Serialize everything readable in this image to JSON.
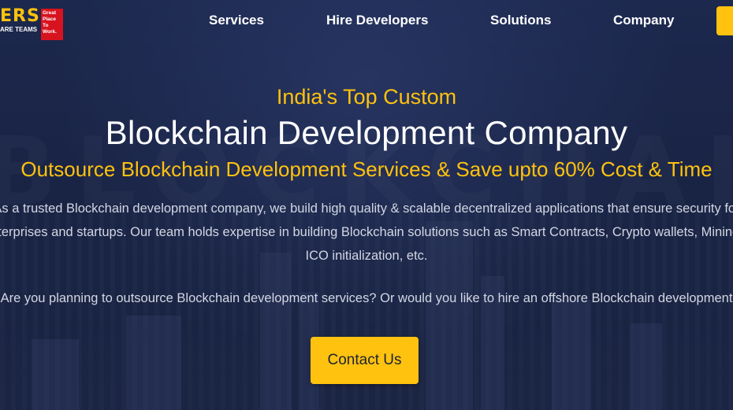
{
  "header": {
    "logo_text": "ERS",
    "logo_sub": "ARE TEAMS",
    "badge_text": "Great Place To Work.",
    "nav": [
      "Services",
      "Hire Developers",
      "Solutions",
      "Company"
    ]
  },
  "hero": {
    "watermark": "BLOCKCHAIN",
    "eyebrow": "India's Top Custom",
    "title": "Blockchain Development Company",
    "tagline": "Outsource Blockchain Development Services & Save upto 60% Cost & Time",
    "paragraph_line1": "As a trusted Blockchain development company, we build high quality & scalable decentralized applications that ensure security for",
    "paragraph_line2": "enterprises and startups. Our team holds expertise in building Blockchain solutions such as Smart Contracts, Crypto wallets, Mining s",
    "paragraph_line3": "ICO initialization, etc.",
    "paragraph2": "Are you planning to outsource Blockchain development services? Or would you like to hire an offshore Blockchain development",
    "cta_label": "Contact Us"
  },
  "colors": {
    "accent": "#ffc20e",
    "background": "#1b2746",
    "badge_red": "#d7131f"
  }
}
